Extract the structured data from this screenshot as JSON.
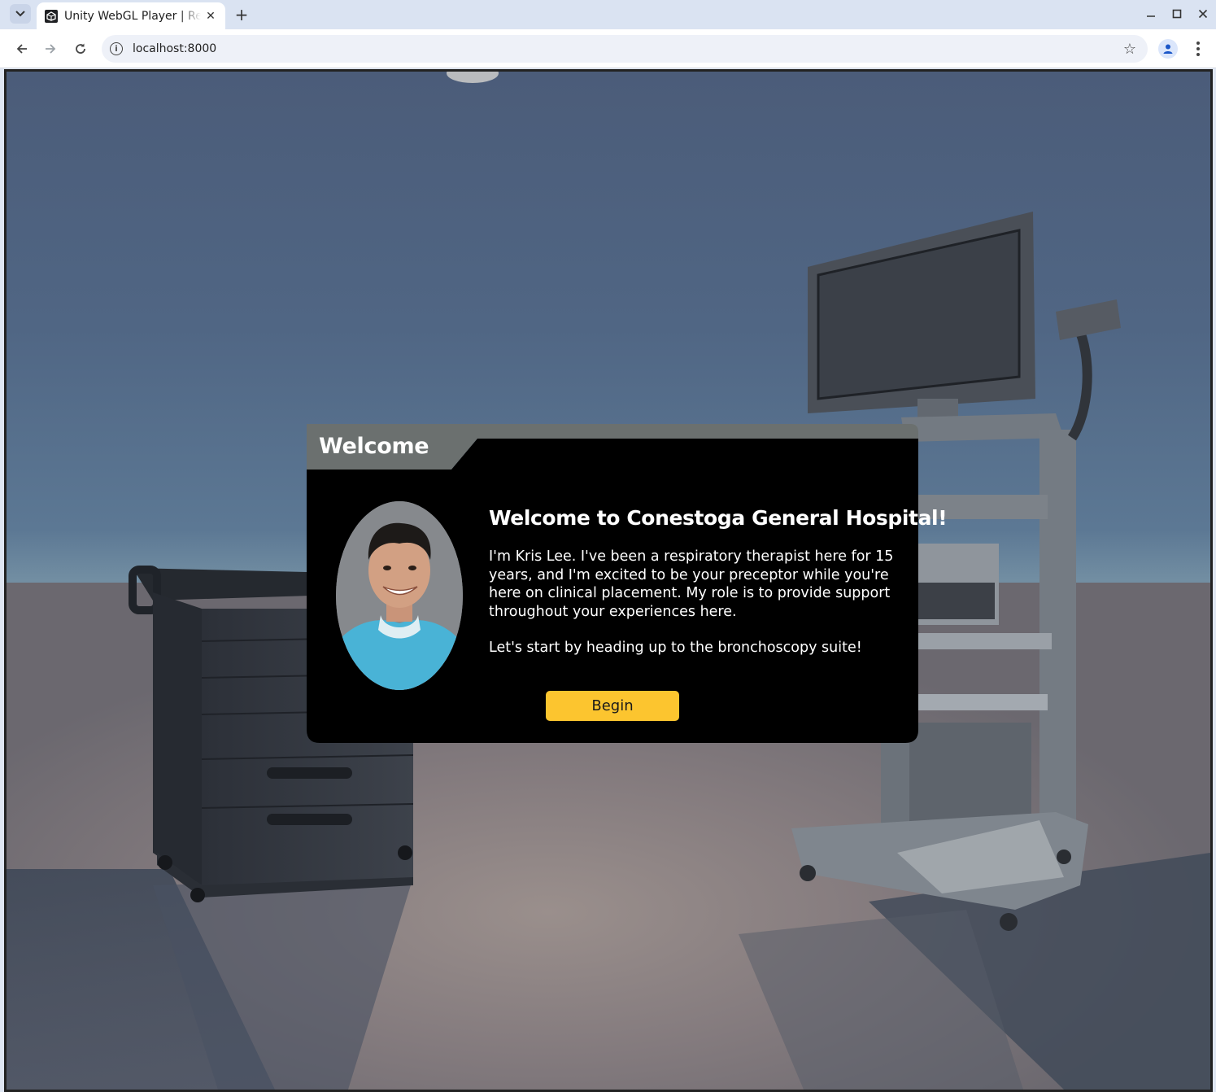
{
  "browser": {
    "tab_title": "Unity WebGL Player | Respiratory Therapy",
    "url": "localhost:8000",
    "icons": {
      "tab_search": "chevron-down-icon",
      "favicon": "unity-icon",
      "tab_close": "close-icon",
      "new_tab": "plus-icon",
      "back": "back-arrow-icon",
      "forward": "forward-arrow-icon",
      "reload": "reload-icon",
      "site_info": "info-icon",
      "bookmark": "star-icon",
      "profile": "profile-icon",
      "menu": "kebab-menu-icon",
      "minimize": "minimize-icon",
      "maximize": "maximize-icon",
      "close_window": "close-icon"
    }
  },
  "dialog": {
    "title": "Welcome",
    "heading": "Welcome to Conestoga General Hospital!",
    "paragraph_1": "I'm Kris Lee. I've been a respiratory therapist here for 15 years, and I'm excited to be your preceptor while you're here on clinical placement. My role is to provide support throughout your experiences here.",
    "paragraph_2": "Let's start by heading up to the bronchoscopy suite!",
    "button_label": "Begin",
    "colors": {
      "panel": "#000000",
      "title_bar": "#6b706f",
      "button": "#fcc52f"
    }
  }
}
